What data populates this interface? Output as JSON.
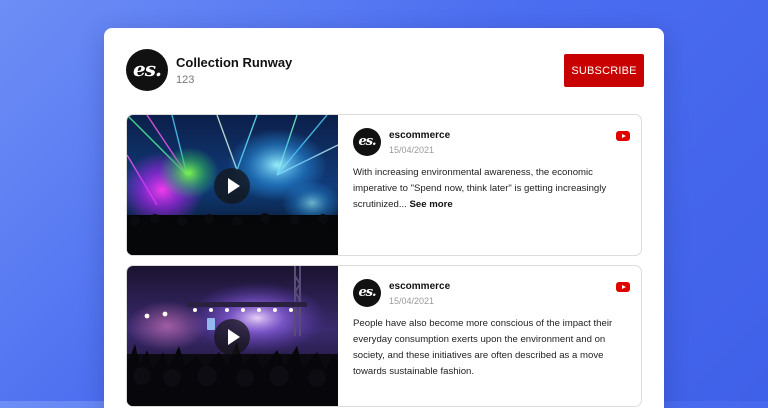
{
  "channel": {
    "avatar_text": "es.",
    "name": "Collection Runway",
    "count": "123",
    "subscribe_label": "SUBSCRIBE"
  },
  "posts": [
    {
      "avatar_text": "es.",
      "author": "escommerce",
      "date": "15/04/2021",
      "text": "With increasing environmental awareness, the economic imperative to \"Spend now, think later\" is getting increasingly scrutinized...",
      "see_more": "See more",
      "thumbnail": "concert-stage-colorful-lights",
      "source_icon": "youtube-icon"
    },
    {
      "avatar_text": "es.",
      "author": "escommerce",
      "date": "15/04/2021",
      "text": "People have also become more conscious of the impact their everyday consumption exerts upon the environment and on society, and these initiatives are often described as a move towards sustainable fashion.",
      "see_more": "",
      "thumbnail": "concert-crowd-purple-lights",
      "source_icon": "youtube-icon"
    }
  ],
  "colors": {
    "subscribe": "#c90000",
    "youtube": "#e00000",
    "background_gradient_start": "#6d8ef5",
    "background_gradient_end": "#3f60e8"
  }
}
